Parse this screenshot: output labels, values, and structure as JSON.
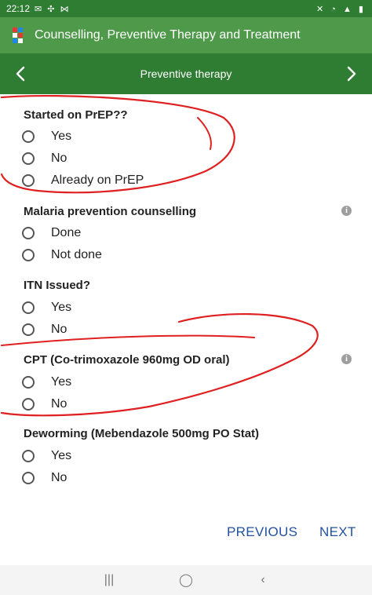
{
  "status_bar": {
    "time": "22:12",
    "left_icons": "✉ ✣ ⋈",
    "right_icons": "✕ ◔ ▲ ▮"
  },
  "app_bar": {
    "title": "Counselling, Preventive Therapy and Treatment",
    "logo_icon": "app-logo-icon"
  },
  "nav_bar": {
    "title": "Preventive therapy",
    "prev_icon": "chevron-left-icon",
    "next_icon": "chevron-right-icon"
  },
  "questions": [
    {
      "label": "Started on PrEP??",
      "info": false,
      "options": [
        "Yes",
        "No",
        "Already on PrEP"
      ]
    },
    {
      "label": "Malaria prevention counselling",
      "info": true,
      "options": [
        "Done",
        "Not done"
      ]
    },
    {
      "label": "ITN Issued?",
      "info": false,
      "options": [
        "Yes",
        "No"
      ]
    },
    {
      "label": "CPT (Co-trimoxazole 960mg OD oral)",
      "info": true,
      "options": [
        "Yes",
        "No"
      ]
    },
    {
      "label": "Deworming (Mebendazole 500mg PO Stat)",
      "info": false,
      "options": [
        "Yes",
        "No"
      ]
    }
  ],
  "footer": {
    "previous": "PREVIOUS",
    "next": "NEXT"
  },
  "system_nav": {
    "recents": "|||",
    "home": "◯",
    "back": "‹"
  },
  "colors": {
    "status_bar": "#2e7d32",
    "app_bar": "#4f9a4a",
    "nav_bar": "#2e7d32",
    "button_text": "#2352a0",
    "annotation": "#e02020"
  }
}
